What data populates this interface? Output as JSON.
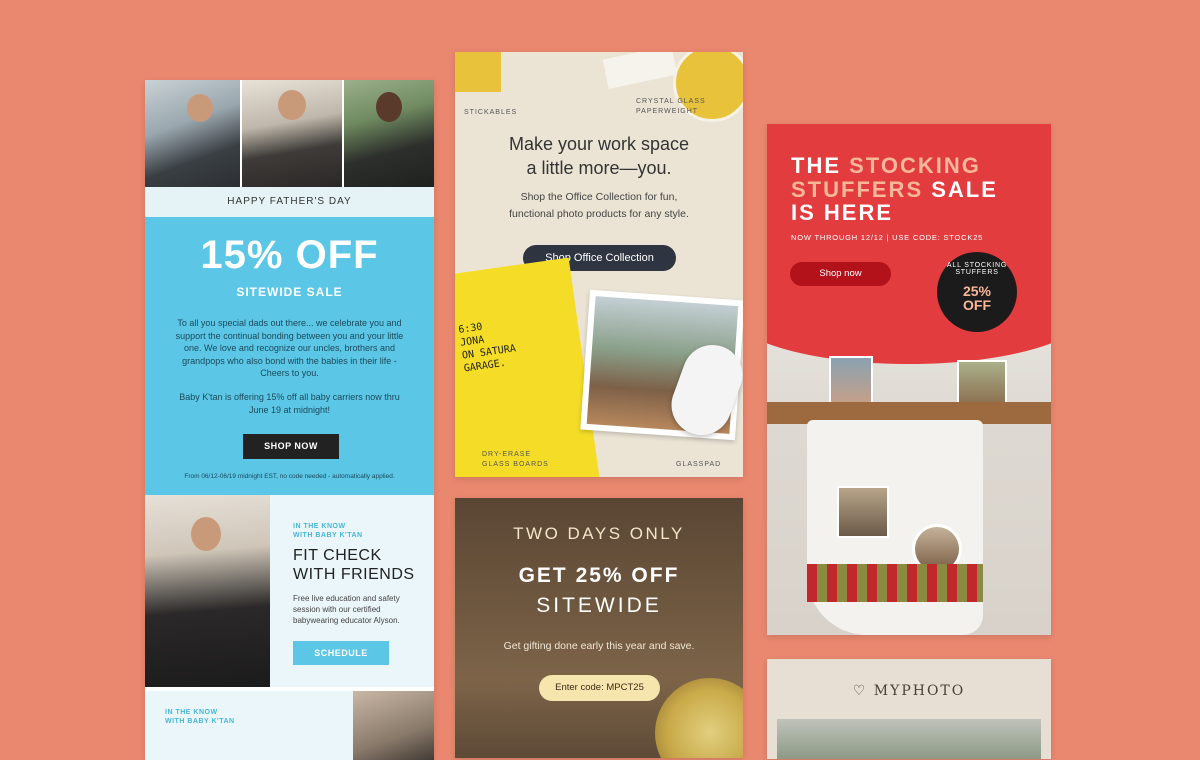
{
  "baby_ktan": {
    "band": "HAPPY FATHER'S DAY",
    "headline": "15% OFF",
    "subhead": "SITEWIDE SALE",
    "paragraph1": "To all you special dads out there... we celebrate you and support the continual bonding between you and your little one. We love and recognize our uncles, brothers and grandpops who also bond with the babies in their life - Cheers to you.",
    "paragraph2": "Baby K'tan is offering 15% off all baby carriers now thru June 19 at midnight!",
    "button": "SHOP NOW",
    "fine_print": "From 06/12-06/19 midnight EST, no code needed - automatically applied.",
    "section2_kicker_1": "IN THE KNOW",
    "section2_kicker_2": "WITH BABY K'TAN",
    "section2_title_1": "FIT CHECK",
    "section2_title_2": "WITH FRIENDS",
    "section2_text": "Free live education and safety session with our certified babywearing educator Alyson.",
    "section2_button": "SCHEDULE",
    "section3_kicker_1": "IN THE KNOW",
    "section3_kicker_2": "WITH BABY K'TAN"
  },
  "office": {
    "label_stickables": "STICKABLES",
    "label_paperweight_1": "CRYSTAL GLASS",
    "label_paperweight_2": "PAPERWEIGHT",
    "title_1": "Make your work space",
    "title_2": "a little more—you.",
    "desc_1": "Shop the Office Collection for fun,",
    "desc_2": "functional photo products for any style.",
    "button": "Shop Office Collection",
    "board_text": "6:30\nJONA\nON SATURA\nGARAGE.",
    "label_board_1": "DRY-ERASE",
    "label_board_2": "GLASS BOARDS",
    "label_glasspad": "GLASSPAD"
  },
  "stocking": {
    "line1_a": "THE",
    "line1_b": "STOCKING",
    "line2_a": "STUFFERS",
    "line2_b": "SALE",
    "line3": "IS HERE",
    "meta": "NOW THROUGH 12/12  |  USE CODE: STOCK25",
    "button": "Shop now",
    "circle_text": "ALL STOCKING STUFFERS",
    "circle_pct": "25%",
    "circle_off": "OFF"
  },
  "two_days": {
    "line1": "TWO DAYS ONLY",
    "line2": "GET 25% OFF",
    "line3": "SITEWIDE",
    "desc": "Get gifting done early this year and save.",
    "code": "Enter code: MPCT25"
  },
  "myphoto": {
    "logo": "MYPHOTO"
  },
  "colors": {
    "background": "#e9876f",
    "ktan_blue": "#5bc6e6",
    "stocking_red": "#e33c3f",
    "office_bg": "#ebe4d5"
  }
}
